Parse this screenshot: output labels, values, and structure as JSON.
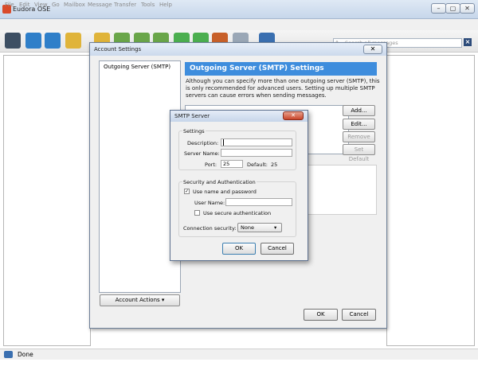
{
  "window": {
    "title": "Eudora OSE",
    "controls": [
      "–",
      "▢",
      "✕"
    ]
  },
  "menu": [
    "File",
    "Edit",
    "View",
    "Go",
    "Mailbox",
    "Message",
    "Transfer",
    "Tools",
    "Help"
  ],
  "search": {
    "placeholder": "Search all messages"
  },
  "status": {
    "text": "Done"
  },
  "account_settings": {
    "title": "Account Settings",
    "close": "✕",
    "list_item": "Outgoing Server (SMTP)",
    "actions_button": "Account Actions",
    "header": "Outgoing Server (SMTP) Settings",
    "description": "Although you can specify more than one outgoing server (SMTP), this is only recommended for advanced users. Setting up multiple SMTP servers can cause errors when sending messages.",
    "buttons": {
      "add": "Add...",
      "edit": "Edit...",
      "remove": "Remove",
      "set_default": "Set Default"
    },
    "ok": "OK",
    "cancel": "Cancel"
  },
  "smtp_dialog": {
    "title": "SMTP Server",
    "close": "✕",
    "settings_group": "Settings",
    "description_label": "Description:",
    "description_value": "",
    "server_name_label": "Server Name:",
    "server_name_value": "",
    "port_label": "Port:",
    "port_value": "25",
    "default_label": "Default:",
    "default_value": "25",
    "security_group": "Security and Authentication",
    "use_name_password": "Use name and password",
    "use_name_password_checked": true,
    "user_name_label": "User Name:",
    "user_name_value": "",
    "secure_auth": "Use secure authentication",
    "secure_auth_checked": false,
    "connection_security_label": "Connection security:",
    "connection_security_value": "None",
    "ok": "OK",
    "cancel": "Cancel"
  }
}
